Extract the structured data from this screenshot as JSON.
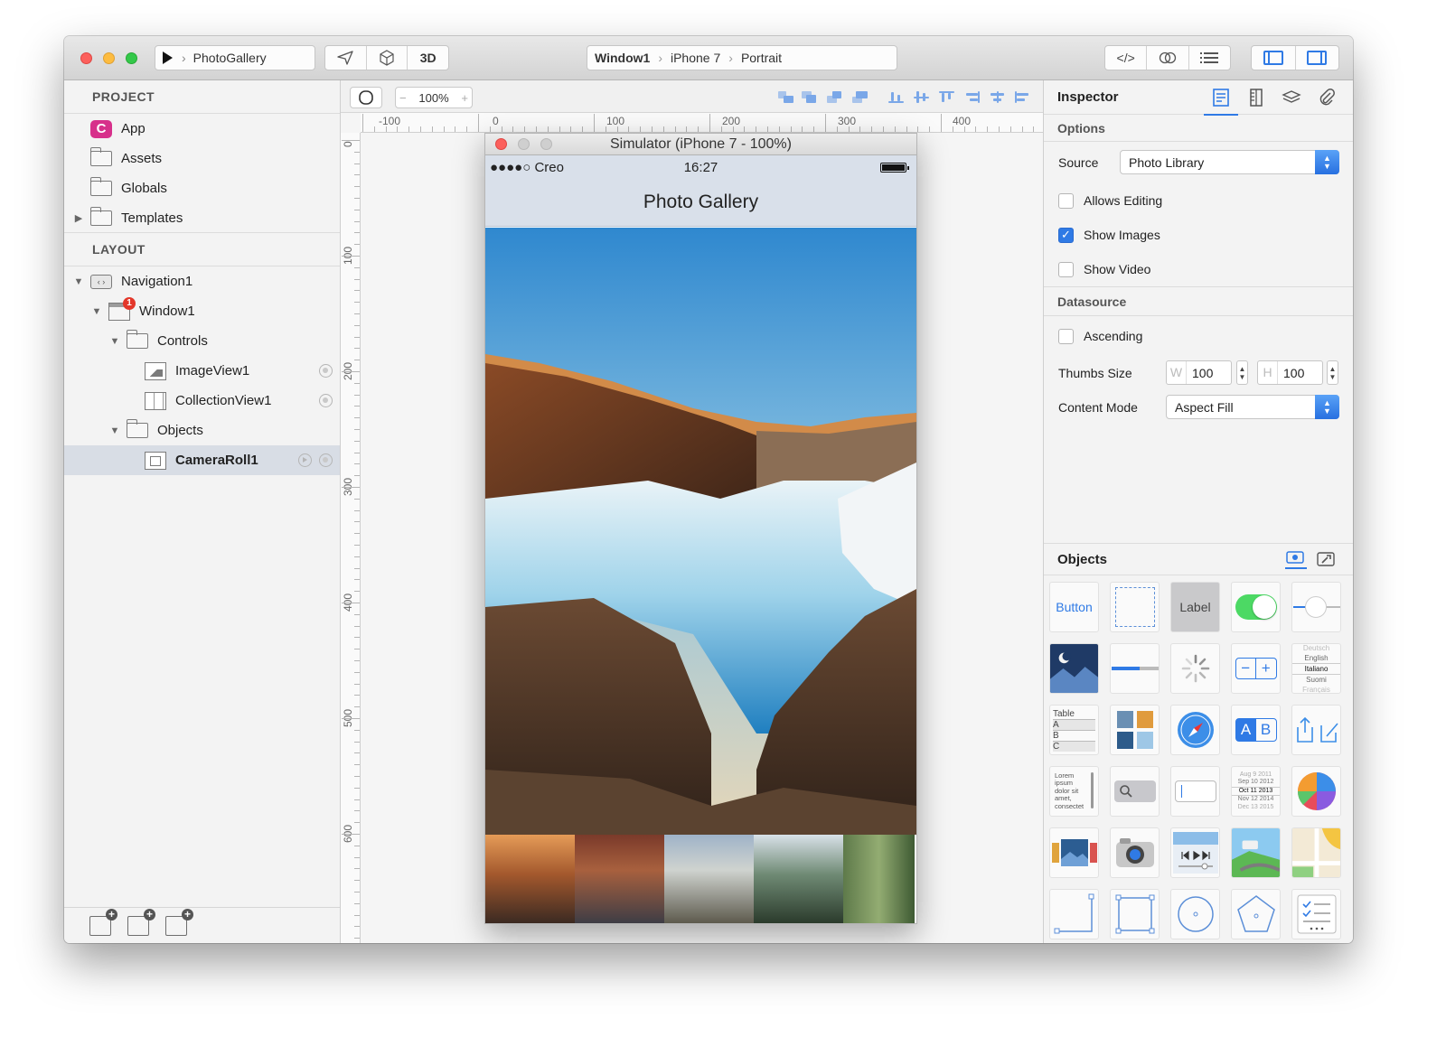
{
  "toolbar": {
    "scheme_name": "PhotoGallery",
    "mode_3d": "3D",
    "breadcrumb": [
      "Window1",
      "iPhone 7",
      "Portrait"
    ],
    "code_label": "</>"
  },
  "sidebar": {
    "project_header": "PROJECT",
    "project_items": [
      {
        "label": "App",
        "icon": "app-icon"
      },
      {
        "label": "Assets",
        "icon": "folder-icon"
      },
      {
        "label": "Globals",
        "icon": "folder-icon"
      },
      {
        "label": "Templates",
        "icon": "folder-icon"
      }
    ],
    "layout_header": "LAYOUT",
    "layout_items": [
      {
        "label": "Navigation1",
        "depth": 0
      },
      {
        "label": "Window1",
        "depth": 1,
        "badge": "1"
      },
      {
        "label": "Controls",
        "depth": 2
      },
      {
        "label": "ImageView1",
        "depth": 3
      },
      {
        "label": "CollectionView1",
        "depth": 3
      },
      {
        "label": "Objects",
        "depth": 2
      },
      {
        "label": "CameraRoll1",
        "depth": 3,
        "selected": true
      }
    ]
  },
  "canvas": {
    "zoom": "100%",
    "ruler_h": [
      "-100",
      "0",
      "100",
      "200",
      "300",
      "400"
    ],
    "ruler_v": [
      "0",
      "100",
      "200",
      "300",
      "400",
      "500",
      "600"
    ],
    "simulator_title": "Simulator (iPhone 7 - 100%)",
    "carrier": "●●●●○ Creo",
    "time": "16:27",
    "nav_title": "Photo Gallery"
  },
  "inspector": {
    "title": "Inspector",
    "options_header": "Options",
    "source_label": "Source",
    "source_value": "Photo Library",
    "allows_editing": {
      "label": "Allows Editing",
      "checked": false
    },
    "show_images": {
      "label": "Show Images",
      "checked": true
    },
    "show_video": {
      "label": "Show Video",
      "checked": false
    },
    "datasource_header": "Datasource",
    "ascending": {
      "label": "Ascending",
      "checked": false
    },
    "thumbs_label": "Thumbs Size",
    "thumbs_w_prefix": "W",
    "thumbs_w": "100",
    "thumbs_h_prefix": "H",
    "thumbs_h": "100",
    "content_mode_label": "Content Mode",
    "content_mode_value": "Aspect Fill",
    "check_mark": "✓"
  },
  "objects": {
    "title": "Objects",
    "button_label": "Button",
    "label_label": "Label",
    "table_lines": [
      "Table",
      "A",
      "B",
      "C"
    ],
    "picker_lines": [
      "Deutsch",
      "English",
      "Italiano",
      "Suomi",
      "Français"
    ],
    "lorem_text": "Lorem ipsum dolor sit amet, consectet",
    "date_lines": [
      "Aug  9  2011",
      "Sep 10 2012",
      "Oct  11 2013",
      "Nov 12 2014",
      "Dec 13 2015"
    ]
  },
  "colors": {
    "accent": "#2f7ae5",
    "app_icon": "#d7308b",
    "toggle_on": "#4cd964",
    "badge": "#e3372a"
  }
}
